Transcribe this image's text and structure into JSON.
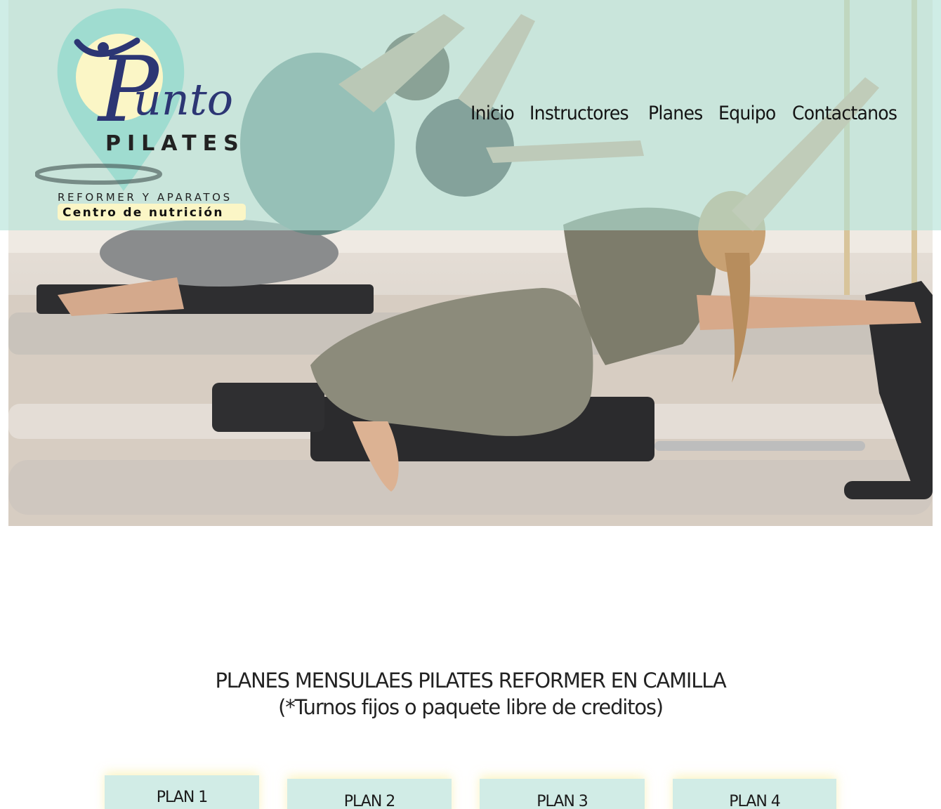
{
  "brand": {
    "logo_word": "unto",
    "logo_initial": "P",
    "logo_subtitle": "PILATES",
    "logo_tagline": "REFORMER Y APARATOS",
    "logo_badge": "Centro de nutrición",
    "colors": {
      "pin": "#9fdcd0",
      "circle": "#fbf6c6",
      "navy": "#2c3674",
      "band": "#b2e2d6"
    }
  },
  "nav": {
    "items": [
      {
        "label": "Inicio"
      },
      {
        "label": "Instructores"
      },
      {
        "label": "Planes"
      },
      {
        "label": "Equipo"
      },
      {
        "label": "Contactanos"
      }
    ]
  },
  "hero": {
    "image": "woman-on-pilates-reformer-photo"
  },
  "plans_section": {
    "title": "PLANES MENSULAES PILATES REFORMER EN CAMILLA",
    "subtitle": "(*Turnos fijos o paquete libre de creditos)",
    "plans": [
      {
        "label": "PLAN 1"
      },
      {
        "label": "PLAN 2"
      },
      {
        "label": "PLAN 3"
      },
      {
        "label": "PLAN 4"
      }
    ]
  }
}
